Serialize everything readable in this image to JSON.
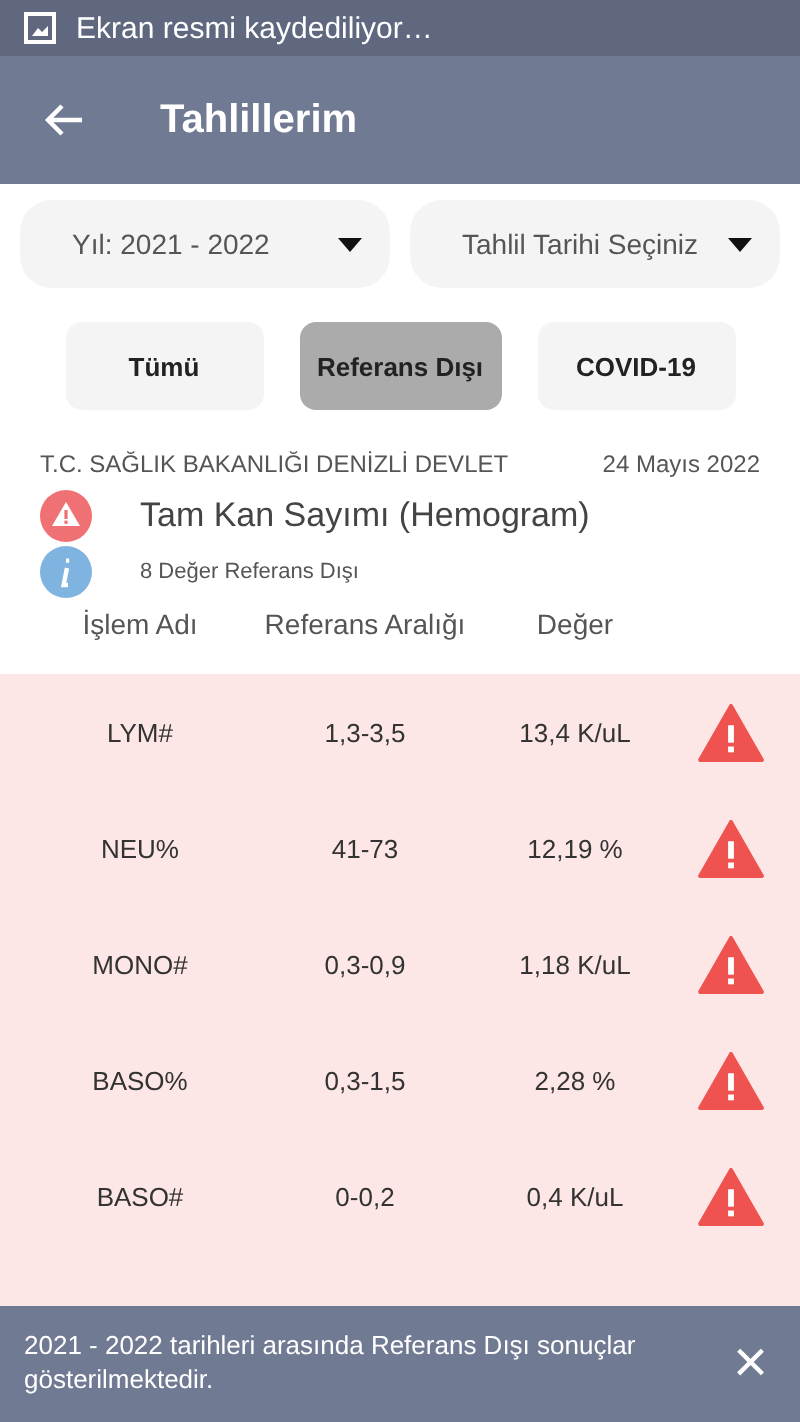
{
  "status_bar": {
    "notification": "Ekran resmi kaydediliyor…"
  },
  "app_bar": {
    "title": "Tahlillerim"
  },
  "filters": [
    {
      "value": "Yıl: 2021 - 2022"
    },
    {
      "value": "Tahlil Tarihi Seçiniz"
    }
  ],
  "tabs": [
    {
      "label": "Tümü",
      "selected": false
    },
    {
      "label": "Referans Dışı",
      "selected": true
    },
    {
      "label": "COVID-19",
      "selected": false
    }
  ],
  "result": {
    "institution": "T.C. SAĞLIK BAKANLIĞI DENİZLİ DEVLET",
    "date": "24 Mayıs 2022",
    "test_name": "Tam Kan Sayımı (Hemogram)",
    "summary": "8 Değer Referans Dışı"
  },
  "table": {
    "columns": [
      "İşlem Adı",
      "Referans Aralığı",
      "Değer"
    ],
    "rows": [
      {
        "name": "LYM#",
        "range": "1,3-3,5",
        "value": "13,4 K/uL",
        "out_of_range": true
      },
      {
        "name": "NEU%",
        "range": "41-73",
        "value": "12,19 %",
        "out_of_range": true
      },
      {
        "name": "MONO#",
        "range": "0,3-0,9",
        "value": "1,18 K/uL",
        "out_of_range": true
      },
      {
        "name": "BASO%",
        "range": "0,3-1,5",
        "value": "2,28 %",
        "out_of_range": true
      },
      {
        "name": "BASO#",
        "range": "0-0,2",
        "value": "0,4 K/uL",
        "out_of_range": true
      }
    ]
  },
  "snackbar": {
    "message": "2021 - 2022 tarihleri arasında Referans Dışı sonuçlar gösterilmektedir.",
    "close": "×"
  }
}
